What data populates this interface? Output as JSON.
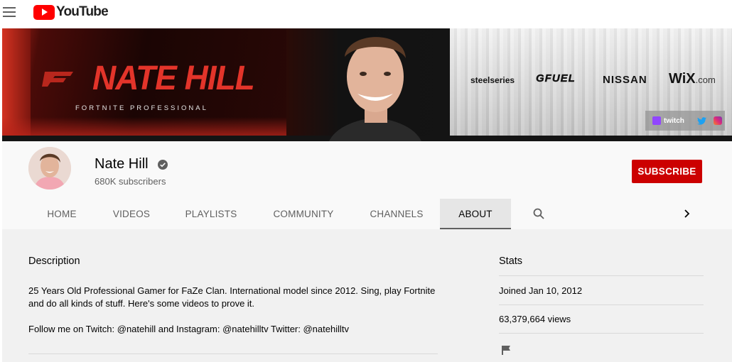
{
  "topbar": {
    "menu_icon": "hamburger-menu-icon",
    "logo_text": "YouTube"
  },
  "banner": {
    "title": "NATE HILL",
    "tagline": "FORTNITE PROFESSIONAL",
    "sponsors": [
      "steelseries",
      "GFUEL",
      "NISSAN",
      "WiX",
      ".com"
    ],
    "social": {
      "twitch_label": "twitch"
    },
    "colors": {
      "accent_red": "#e3342a",
      "dark": "#141414"
    }
  },
  "channel": {
    "name": "Nate Hill",
    "subscribers": "680K subscribers",
    "subscribe_label": "SUBSCRIBE",
    "subscribe_color": "#cc0000"
  },
  "tabs": [
    {
      "label": "HOME",
      "active": false
    },
    {
      "label": "VIDEOS",
      "active": false
    },
    {
      "label": "PLAYLISTS",
      "active": false
    },
    {
      "label": "COMMUNITY",
      "active": false
    },
    {
      "label": "CHANNELS",
      "active": false
    },
    {
      "label": "ABOUT",
      "active": true
    }
  ],
  "about": {
    "description_heading": "Description",
    "description_lines": [
      "25 Years Old Professional Gamer for FaZe Clan. International model since 2012. Sing, play Fortnite and do all kinds of stuff. Here's some videos to prove it.",
      "Follow me on Twitch: @natehill and Instagram: @natehilltv Twitter: @natehilltv"
    ],
    "stats_heading": "Stats",
    "joined": "Joined Jan 10, 2012",
    "views": "63,379,664 views"
  }
}
